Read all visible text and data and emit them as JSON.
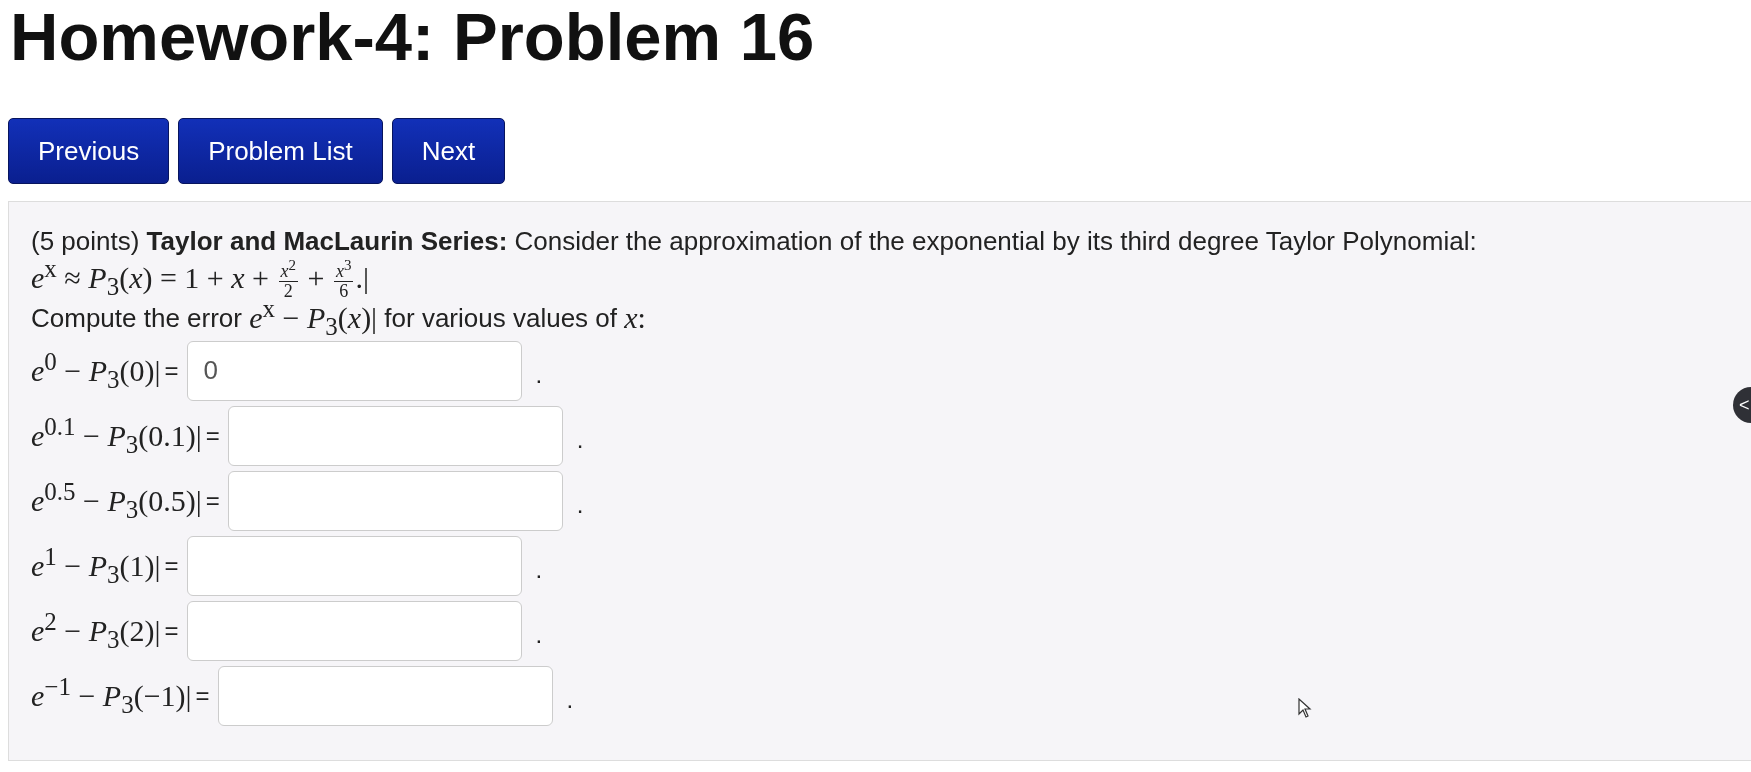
{
  "title": "Homework-4: Problem 16",
  "nav_buttons": [
    "Previous",
    "Problem List",
    "Next"
  ],
  "problem": {
    "points": "(5 points)",
    "heading": "Taylor and MacLaurin Series:",
    "intro": "Consider the approximation of the exponential by its third degree Taylor Polynomial:",
    "formula": [
      {
        "kind": "math",
        "text": "*e*$^{x}$ ≈ *P*$_{3}$(*x*) = 1 + *x* + "
      },
      {
        "kind": "frac",
        "num": "*x*$^{2}$",
        "den": "2"
      },
      {
        "kind": "math",
        "text": " + "
      },
      {
        "kind": "frac",
        "num": "*x*$^{3}$",
        "den": "6"
      },
      {
        "kind": "math",
        "text": ".|"
      }
    ],
    "prompt": [
      {
        "kind": "text",
        "text": "Compute the error "
      },
      {
        "kind": "math",
        "text": "*e*$^{x}$ − *P*$_{3}$(*x*)|"
      },
      {
        "kind": "text",
        "text": " for various values of "
      },
      {
        "kind": "math",
        "text": "*x*:"
      }
    ],
    "answers": [
      {
        "label": "*e*$^{0}$ − *P*$_{3}$(0)|",
        "equals": "=",
        "value": "0",
        "end": "."
      },
      {
        "label": "*e*$^{0.1}$ − *P*$_{3}$(0.1)|",
        "equals": "=",
        "end": "."
      },
      {
        "label": "*e*$^{0.5}$ − *P*$_{3}$(0.5)|",
        "equals": "=",
        "end": "."
      },
      {
        "label": "*e*$^{1}$ − *P*$_{3}$(1)|",
        "equals": "=",
        "end": "."
      },
      {
        "label": "*e*$^{2}$ − *P*$_{3}$(2)|",
        "equals": "=",
        "end": "."
      },
      {
        "label": "*e*$^{−1}$ − *P*$_{3}$(−1)|",
        "equals": "=",
        "end": "."
      }
    ]
  },
  "side_toggle": {
    "glyph": "<"
  }
}
